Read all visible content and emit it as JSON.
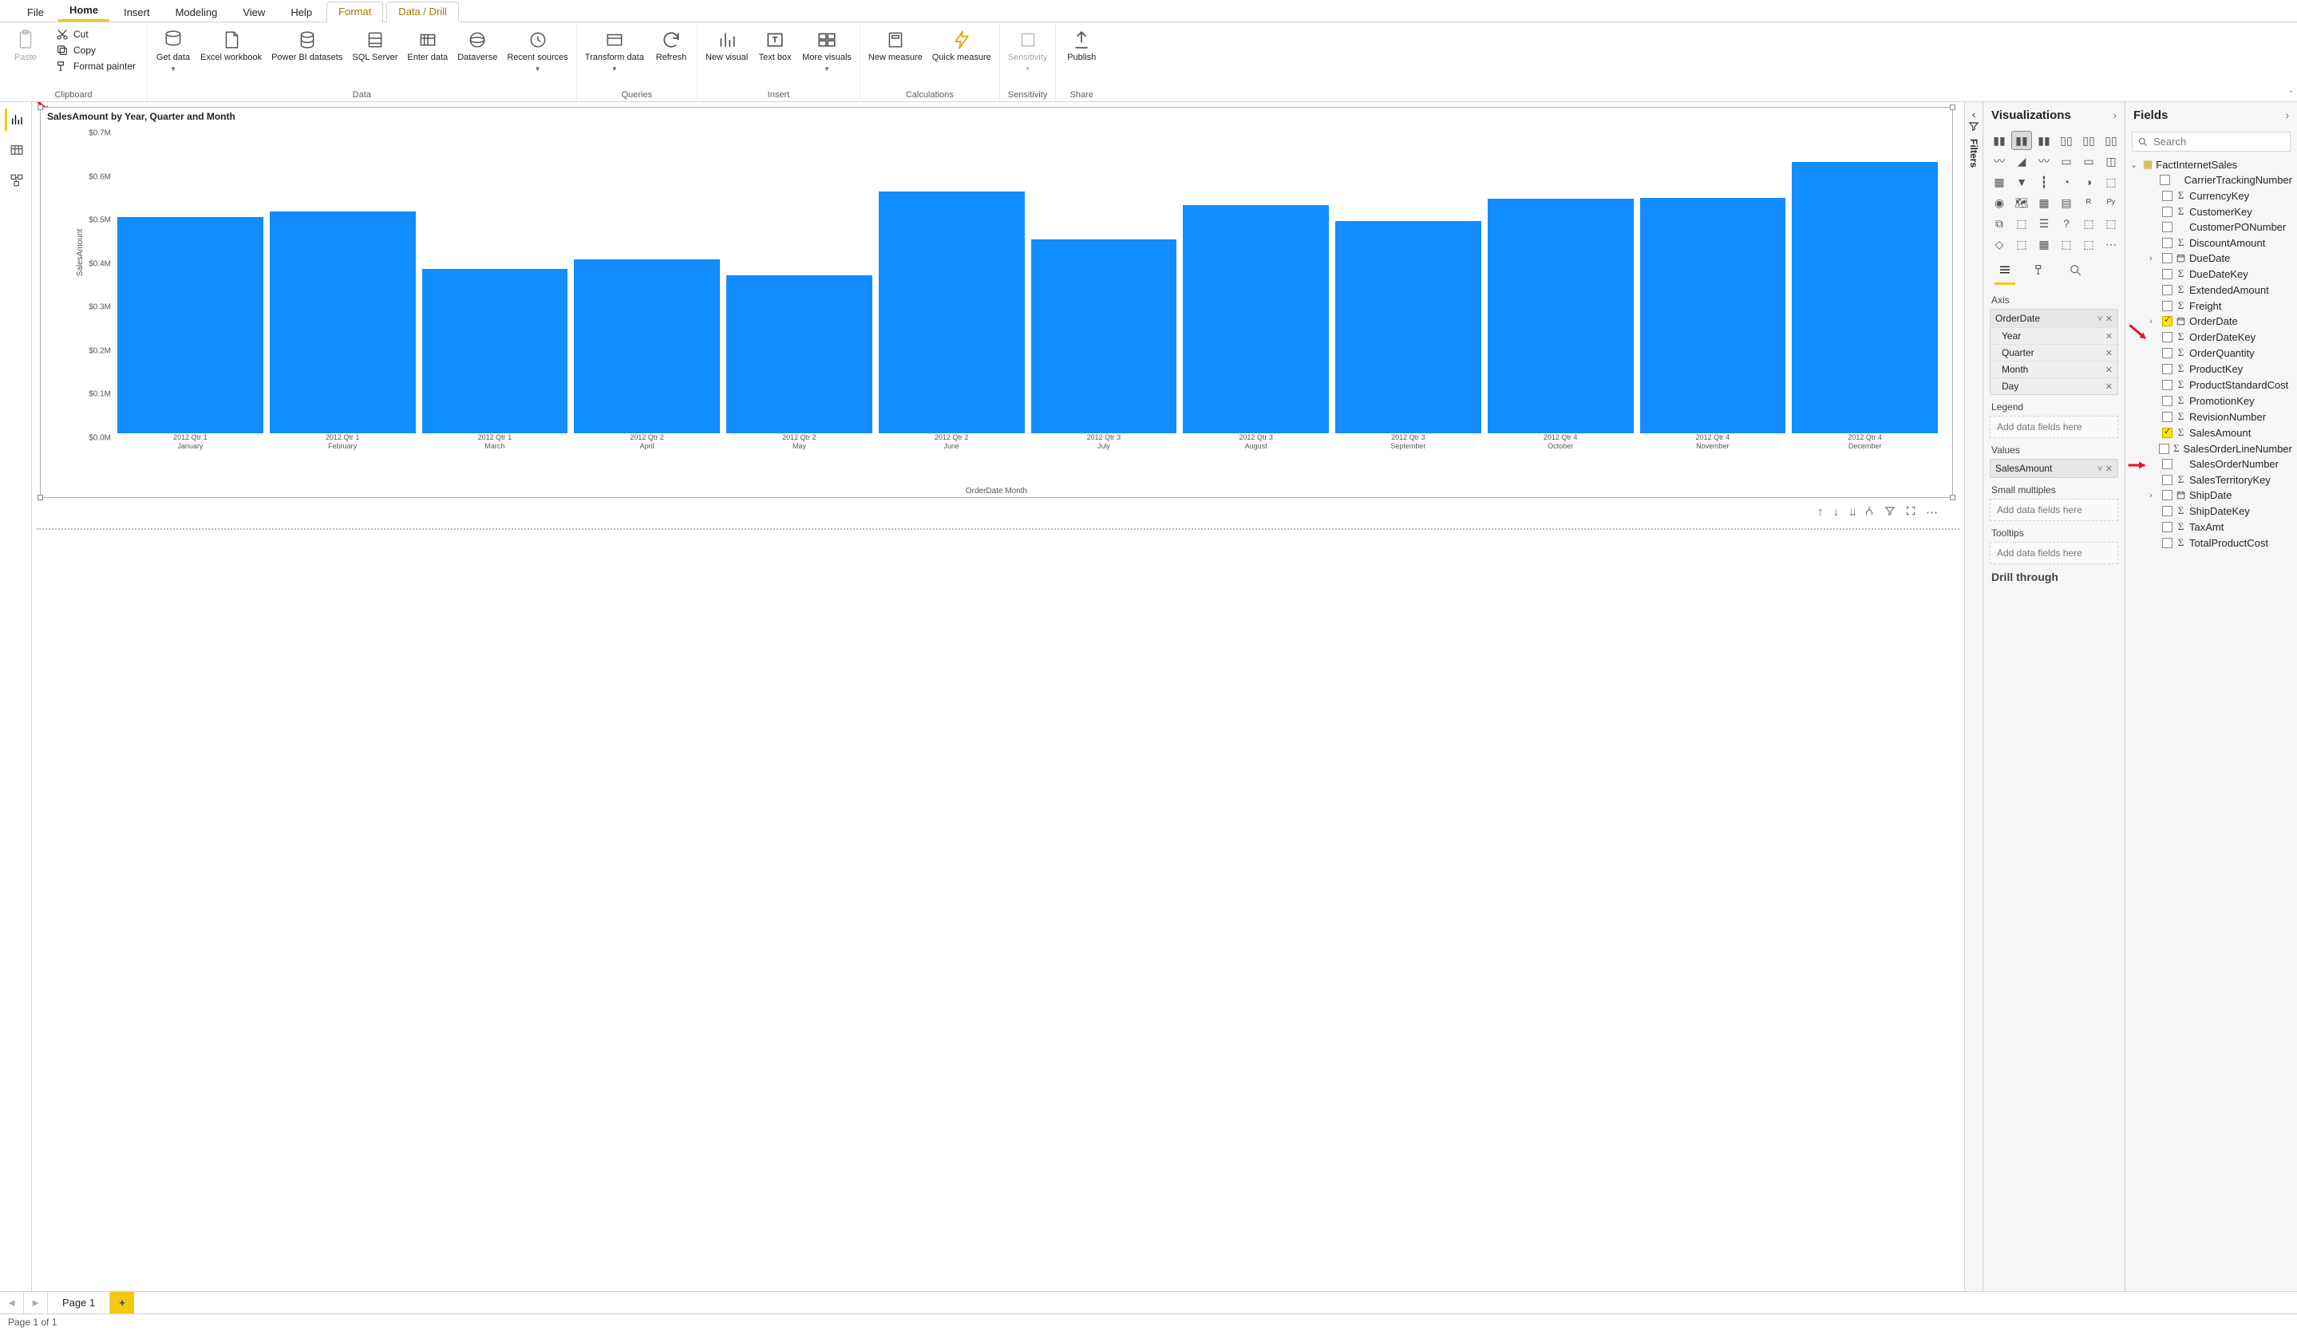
{
  "menu": {
    "items": [
      "File",
      "Home",
      "Insert",
      "Modeling",
      "View",
      "Help"
    ],
    "context": [
      "Format",
      "Data / Drill"
    ],
    "active": "Home"
  },
  "ribbon": {
    "paste": "Paste",
    "cut": "Cut",
    "copy": "Copy",
    "format_painter": "Format painter",
    "clipboard_group": "Clipboard",
    "get_data": "Get data",
    "excel": "Excel workbook",
    "pbi_ds": "Power BI datasets",
    "sql": "SQL Server",
    "enter": "Enter data",
    "dataverse": "Dataverse",
    "recent": "Recent sources",
    "data_group": "Data",
    "transform": "Transform data",
    "refresh": "Refresh",
    "queries_group": "Queries",
    "new_vis": "New visual",
    "text_box": "Text box",
    "more_vis": "More visuals",
    "insert_group": "Insert",
    "new_meas": "New measure",
    "quick_meas": "Quick measure",
    "calc_group": "Calculations",
    "sensitivity": "Sensitivity",
    "sens_group": "Sensitivity",
    "publish": "Publish",
    "share_group": "Share"
  },
  "visual": {
    "title": "SalesAmount by Year, Quarter and Month",
    "ylabel": "SalesAmount",
    "xlabel": "OrderDate Month"
  },
  "chart_data": {
    "type": "bar",
    "title": "SalesAmount by Year, Quarter and Month",
    "xlabel": "OrderDate Month",
    "ylabel": "SalesAmount",
    "ylim": [
      0,
      700000
    ],
    "yticks": [
      "$0.0M",
      "$0.1M",
      "$0.2M",
      "$0.3M",
      "$0.4M",
      "$0.5M",
      "$0.6M",
      "$0.7M"
    ],
    "categories": [
      [
        "2012 Qtr 1",
        "January"
      ],
      [
        "2012 Qtr 1",
        "February"
      ],
      [
        "2012 Qtr 1",
        "March"
      ],
      [
        "2012 Qtr 2",
        "April"
      ],
      [
        "2012 Qtr 2",
        "May"
      ],
      [
        "2012 Qtr 2",
        "June"
      ],
      [
        "2012 Qtr 3",
        "July"
      ],
      [
        "2012 Qtr 3",
        "August"
      ],
      [
        "2012 Qtr 3",
        "September"
      ],
      [
        "2012 Qtr 4",
        "October"
      ],
      [
        "2012 Qtr 4",
        "November"
      ],
      [
        "2012 Qtr 4",
        "December"
      ]
    ],
    "values": [
      497000,
      510000,
      378000,
      400000,
      362000,
      556000,
      445000,
      525000,
      488000,
      538000,
      540000,
      623000
    ]
  },
  "vis_pane": {
    "title": "Visualizations",
    "tabs": {
      "axis": "Axis",
      "legend": "Legend",
      "values": "Values",
      "small_mult": "Small multiples",
      "tooltips": "Tooltips",
      "drill": "Drill through"
    },
    "axis_field": "OrderDate",
    "axis_items": [
      "Year",
      "Quarter",
      "Month",
      "Day"
    ],
    "values_field": "SalesAmount",
    "placeholder": "Add data fields here"
  },
  "fields": {
    "title": "Fields",
    "search": "Search",
    "table": "FactInternetSales",
    "items": [
      {
        "n": "CarrierTrackingNumber"
      },
      {
        "n": "CurrencyKey",
        "s": true
      },
      {
        "n": "CustomerKey",
        "s": true
      },
      {
        "n": "CustomerPONumber"
      },
      {
        "n": "DiscountAmount",
        "s": true
      },
      {
        "n": "DueDate",
        "cal": true,
        "exp": true
      },
      {
        "n": "DueDateKey",
        "s": true
      },
      {
        "n": "ExtendedAmount",
        "s": true
      },
      {
        "n": "Freight",
        "s": true
      },
      {
        "n": "OrderDate",
        "cal": true,
        "exp": true,
        "chk": true
      },
      {
        "n": "OrderDateKey",
        "s": true
      },
      {
        "n": "OrderQuantity",
        "s": true
      },
      {
        "n": "ProductKey",
        "s": true
      },
      {
        "n": "ProductStandardCost",
        "s": true
      },
      {
        "n": "PromotionKey",
        "s": true
      },
      {
        "n": "RevisionNumber",
        "s": true
      },
      {
        "n": "SalesAmount",
        "s": true,
        "chk": true
      },
      {
        "n": "SalesOrderLineNumber",
        "s": true
      },
      {
        "n": "SalesOrderNumber"
      },
      {
        "n": "SalesTerritoryKey",
        "s": true
      },
      {
        "n": "ShipDate",
        "cal": true,
        "exp": true
      },
      {
        "n": "ShipDateKey",
        "s": true
      },
      {
        "n": "TaxAmt",
        "s": true
      },
      {
        "n": "TotalProductCost",
        "s": true
      }
    ]
  },
  "filters_label": "Filters",
  "page": {
    "tab": "Page 1",
    "status": "Page 1 of 1"
  }
}
